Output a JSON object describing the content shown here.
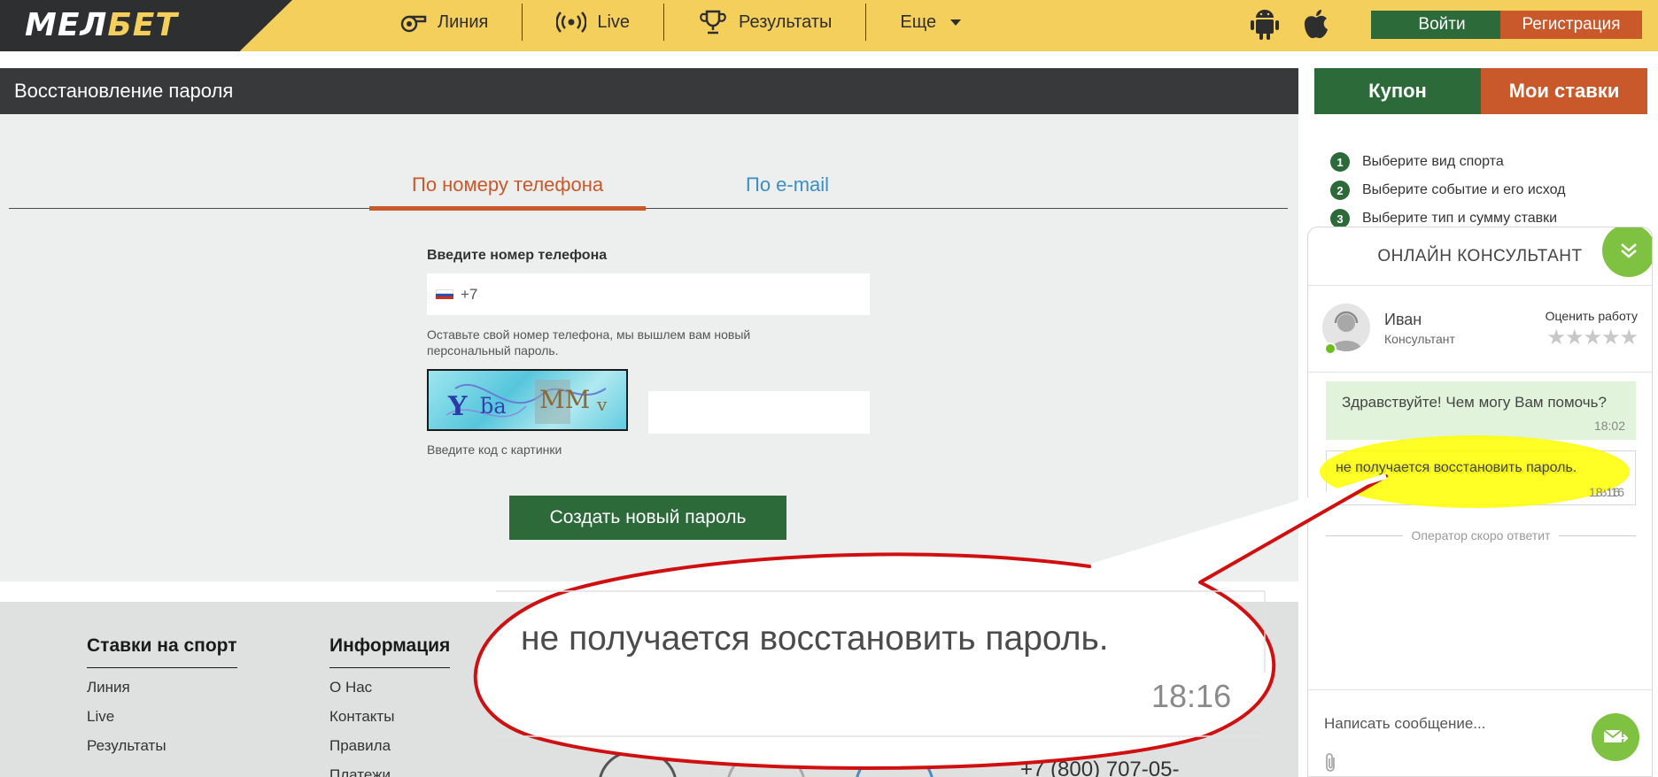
{
  "header": {
    "logo_main": "МЕЛ",
    "logo_accent": "БЕТ",
    "nav": [
      {
        "label": "Линия",
        "icon": "whistle-icon"
      },
      {
        "label": "Live",
        "icon": "broadcast-icon"
      },
      {
        "label": "Результаты",
        "icon": "trophy-icon"
      },
      {
        "label": "Еще",
        "icon": "chevron-down-icon"
      }
    ],
    "login_label": "Войти",
    "register_label": "Регистрация"
  },
  "page": {
    "title": "Восстановление пароля",
    "tabs": [
      {
        "label": "По номеру телефона",
        "active": true
      },
      {
        "label": "По e-mail",
        "active": false
      }
    ],
    "phone_label": "Введите номер телефона",
    "phone_prefix": "+7",
    "phone_hint": "Оставьте свой номер телефона, мы вышлем вам новый персональный пароль.",
    "captcha_text": "Y   MM",
    "captcha_hint": "Введите код с картинки",
    "submit_label": "Создать новый пароль"
  },
  "footer": {
    "columns": [
      {
        "title": "Ставки на спорт",
        "items": [
          "Линия",
          "Live",
          "Результаты"
        ]
      },
      {
        "title": "Информация",
        "items": [
          "О Нас",
          "Контакты",
          "Правила",
          "Платежи"
        ]
      }
    ],
    "phone": "+7 (800) 707-05-"
  },
  "coupon": {
    "tab_coupon": "Купон",
    "tab_bets": "Мои ставки",
    "steps": [
      "Выберите вид спорта",
      "Выберите событие и его исход",
      "Выберите тип и сумму ставки"
    ]
  },
  "chat": {
    "header": "ОНЛАЙН КОНСУЛЬТАНТ",
    "agent_name": "Иван",
    "agent_role": "Консультант",
    "rate_label": "Оценить работу",
    "messages": [
      {
        "text": "Здравствуйте! Чем могу Вам помочь?",
        "time": "18:02"
      },
      {
        "text": "не получается восстановить пароль.",
        "time": "18:16"
      }
    ],
    "status": "Оператор скоро ответит",
    "input_placeholder": "Написать сообщение..."
  },
  "callout": {
    "text": "не получается восстановить пароль.",
    "time": "18:16"
  },
  "colors": {
    "header_bg": "#f5cf5c",
    "brand_green": "#2d6a3a",
    "brand_orange": "#c9582a",
    "chat_green": "#7fc241",
    "highlight": "#ffff00",
    "callout_border": "#d01010"
  }
}
